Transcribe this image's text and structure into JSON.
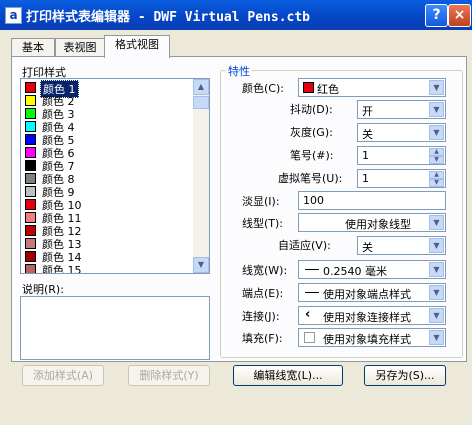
{
  "window": {
    "title": "打印样式表编辑器 - DWF Virtual Pens.ctb",
    "app_icon": "a",
    "help_label": "?",
    "close_label": "×"
  },
  "tabs": [
    {
      "label": "基本",
      "active": false
    },
    {
      "label": "表视图",
      "active": false
    },
    {
      "label": "格式视图",
      "active": true
    }
  ],
  "left": {
    "styles_label": "打印样式",
    "styles": [
      {
        "label": "颜色 1",
        "color": "#e4000c",
        "selected": true
      },
      {
        "label": "颜色 2",
        "color": "#ffff00",
        "selected": false
      },
      {
        "label": "颜色 3",
        "color": "#00ff00",
        "selected": false
      },
      {
        "label": "颜色 4",
        "color": "#00ffff",
        "selected": false
      },
      {
        "label": "颜色 5",
        "color": "#0000ff",
        "selected": false
      },
      {
        "label": "颜色 6",
        "color": "#ff00ff",
        "selected": false
      },
      {
        "label": "颜色 7",
        "color": "#000000",
        "selected": false
      },
      {
        "label": "颜色 8",
        "color": "#808080",
        "selected": false
      },
      {
        "label": "颜色 9",
        "color": "#c0c0c0",
        "selected": false
      },
      {
        "label": "颜色 10",
        "color": "#e4000c",
        "selected": false
      },
      {
        "label": "颜色 11",
        "color": "#f08080",
        "selected": false
      },
      {
        "label": "颜色 12",
        "color": "#c00000",
        "selected": false
      },
      {
        "label": "颜色 13",
        "color": "#c87878",
        "selected": false
      },
      {
        "label": "颜色 14",
        "color": "#a00000",
        "selected": false
      },
      {
        "label": "颜色 15",
        "color": "#b46464",
        "selected": false
      }
    ],
    "description_label": "说明(R):"
  },
  "properties": {
    "group_label": "特性",
    "color_label": "颜色(C):",
    "color_value": "红色",
    "color_swatch": "#e4000c",
    "dither_label": "抖动(D):",
    "dither_value": "开",
    "grayscale_label": "灰度(G):",
    "grayscale_value": "关",
    "pen_label": "笔号(#):",
    "pen_value": "1",
    "virtual_pen_label": "虚拟笔号(U):",
    "virtual_pen_value": "1",
    "screening_label": "淡显(I):",
    "screening_value": "100",
    "linetype_label": "线型(T):",
    "linetype_value": "使用对象线型",
    "adaptive_label": "自适应(V):",
    "adaptive_value": "关",
    "lineweight_label": "线宽(W):",
    "lineweight_value": "0.2540 毫米",
    "end_label": "端点(E):",
    "end_value": "使用对象端点样式",
    "join_label": "连接(J):",
    "join_value": "使用对象连接样式",
    "fill_label": "填充(F):",
    "fill_value": "使用对象填充样式"
  },
  "buttons": {
    "add_style": "添加样式(A)",
    "delete_style": "删除样式(Y)",
    "edit_lineweights": "编辑线宽(L)...",
    "save_as": "另存为(S)..."
  }
}
